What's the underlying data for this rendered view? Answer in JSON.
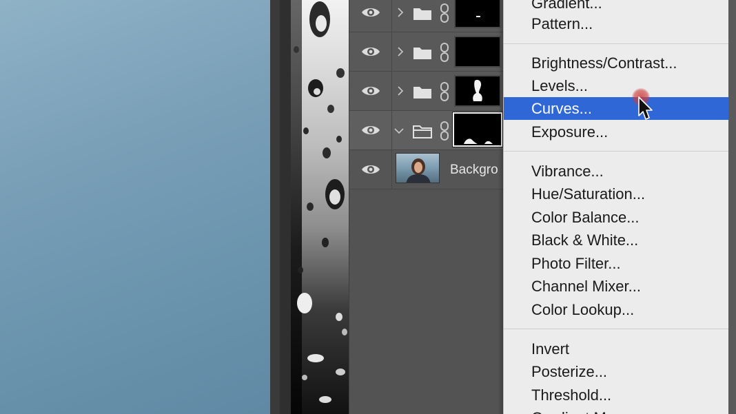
{
  "layers": [
    {
      "type": "group",
      "expanded": false,
      "mask": "dash"
    },
    {
      "type": "group",
      "expanded": false,
      "mask": "black"
    },
    {
      "type": "group",
      "expanded": false,
      "mask": "figure"
    },
    {
      "type": "group",
      "expanded": true,
      "mask": "blobs",
      "selected": true
    },
    {
      "type": "pixel",
      "name": "Backgro"
    }
  ],
  "menu": {
    "items": [
      {
        "label": "Gradient...",
        "highlight": false
      },
      {
        "label": "Pattern...",
        "highlight": false
      },
      {
        "label": "Brightness/Contrast...",
        "highlight": false
      },
      {
        "label": "Levels...",
        "highlight": false
      },
      {
        "label": "Curves...",
        "highlight": true
      },
      {
        "label": "Exposure...",
        "highlight": false
      },
      {
        "label": "Vibrance...",
        "highlight": false
      },
      {
        "label": "Hue/Saturation...",
        "highlight": false
      },
      {
        "label": "Color Balance...",
        "highlight": false
      },
      {
        "label": "Black & White...",
        "highlight": false
      },
      {
        "label": "Photo Filter...",
        "highlight": false
      },
      {
        "label": "Channel Mixer...",
        "highlight": false
      },
      {
        "label": "Color Lookup...",
        "highlight": false
      },
      {
        "label": "Invert",
        "highlight": false
      },
      {
        "label": "Posterize...",
        "highlight": false
      },
      {
        "label": "Threshold...",
        "highlight": false
      },
      {
        "label": "Gradient Map...",
        "highlight": false
      }
    ]
  },
  "colors": {
    "menu_highlight": "#2f67d6",
    "menu_background": "#ececec",
    "panel_background": "#535353",
    "canvas_blue": "#7aa0b8"
  }
}
